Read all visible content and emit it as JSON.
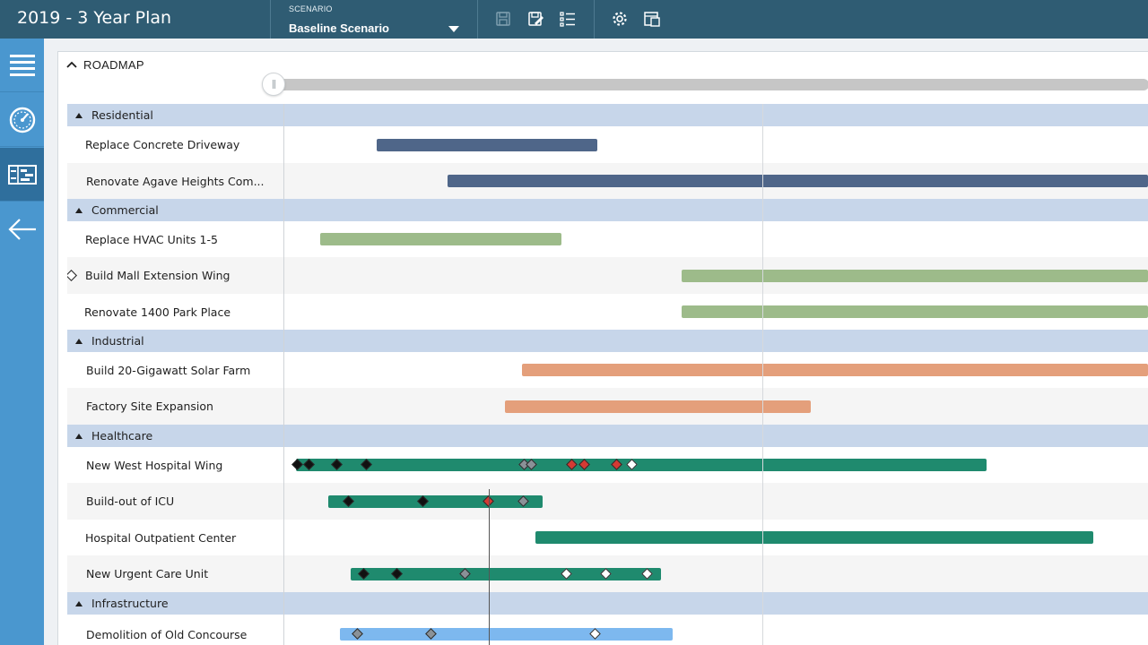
{
  "app": {
    "title": "2019 - 3 Year Plan"
  },
  "scenario": {
    "caption": "SCENARIO",
    "value": "Baseline Scenario"
  },
  "toolbar": {
    "icons": [
      "save-icon",
      "save-as-icon",
      "checklist-icon",
      "settings-icon",
      "export-icon"
    ]
  },
  "sidebar": {
    "items": [
      {
        "icon": "menu-icon"
      },
      {
        "icon": "dashboard-gauge-icon"
      },
      {
        "icon": "roadmap-icon",
        "active": true
      },
      {
        "icon": "back-arrow-icon"
      }
    ]
  },
  "roadmap": {
    "title": "ROADMAP"
  },
  "colors": {
    "residential": "#4f6689",
    "commercial": "#9dbb8a",
    "industrial": "#e49f7b",
    "healthcare": "#1f8a6e",
    "infrastructure": "#7db8ef",
    "group_band": "#c7d6ea",
    "milestone_black": "#111111",
    "milestone_red": "#d43a34",
    "milestone_gray": "#8a9197",
    "milestone_white": "#ffffff"
  },
  "groups": [
    {
      "name": "Residential",
      "color_key": "residential",
      "tasks": [
        {
          "name": "Replace Concrete Driveway",
          "milestones": []
        },
        {
          "name": "Renovate Agave Heights Com...",
          "milestones": []
        }
      ]
    },
    {
      "name": "Commercial",
      "color_key": "commercial",
      "tasks": [
        {
          "name": "Replace HVAC Units 1-5",
          "milestones": []
        },
        {
          "name": "Build Mall Extension Wing",
          "milestones": [
            "gray",
            "white",
            "white",
            "white"
          ]
        },
        {
          "name": "Renovate 1400 Park Place",
          "milestones": []
        }
      ]
    },
    {
      "name": "Industrial",
      "color_key": "industrial",
      "tasks": [
        {
          "name": "Build 20-Gigawatt Solar Farm",
          "milestones": []
        },
        {
          "name": "Factory Site Expansion",
          "milestones": []
        }
      ]
    },
    {
      "name": "Healthcare",
      "color_key": "healthcare",
      "tasks": [
        {
          "name": "New West Hospital Wing",
          "milestones": [
            "black",
            "black",
            "black",
            "black",
            "gray",
            "gray",
            "red",
            "red",
            "red",
            "white"
          ]
        },
        {
          "name": "Build-out of ICU",
          "milestones": [
            "black",
            "black",
            "red",
            "gray"
          ]
        },
        {
          "name": "Hospital Outpatient Center",
          "milestones": []
        },
        {
          "name": "New Urgent Care Unit",
          "milestones": [
            "black",
            "black",
            "gray",
            "white",
            "white",
            "white"
          ]
        }
      ]
    },
    {
      "name": "Infrastructure",
      "color_key": "infrastructure",
      "tasks": [
        {
          "name": "Demolition of Old Concourse",
          "milestones": [
            "gray",
            "gray",
            "white"
          ]
        }
      ]
    }
  ]
}
